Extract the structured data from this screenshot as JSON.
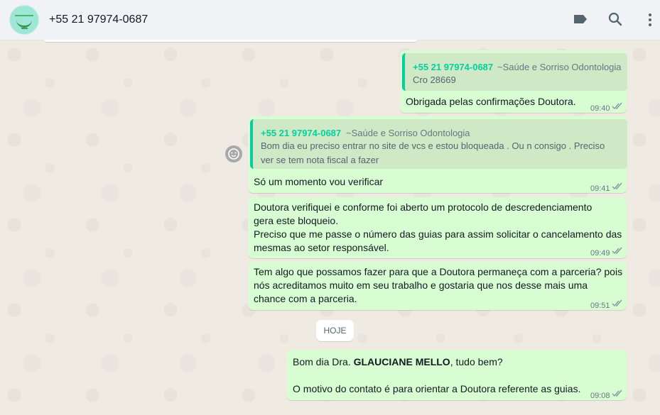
{
  "header": {
    "contact_name": "+55 21 97974-0687",
    "icons": [
      "label-icon",
      "search-icon",
      "menu-icon"
    ]
  },
  "colors": {
    "outgoing_bubble": "#d9fdd3",
    "quote_accent": "#06cf9c",
    "header_bg": "#f0f2f5",
    "chat_bg": "#efeae2"
  },
  "messages": [
    {
      "quote": {
        "sender": "+55 21 97974-0687",
        "push_name": "~Saúde e Sorriso Odontologia",
        "text": "Cro 28669"
      },
      "text": "Obrigada pelas confirmações Doutora.",
      "time": "09:40"
    },
    {
      "quote": {
        "sender": "+55 21 97974-0687",
        "push_name": "~Saúde e Sorriso Odontologia",
        "text_line1": "Bom dia eu preciso entrar no site de vcs e estou bloqueada . Ou n consigo . Preciso",
        "text_line2": "ver se tem nota fiscal a fazer"
      },
      "text": "Só um momento vou verificar",
      "time": "09:41"
    },
    {
      "text": "Doutora verifiquei e conforme foi aberto um protocolo de descredenciamento\ngera este bloqueio.\nPreciso que me passe o número das guias para assim solicitar o cancelamento das\nmesmas ao setor responsável.",
      "time": "09:49"
    },
    {
      "text": "Tem algo que possamos fazer para que a Doutora permaneça com a parceria? pois\nnós acreditamos muito em seu trabalho e gostaria que nos desse mais uma\nchance com a parceria.",
      "time": "09:51"
    },
    {
      "text_before_bold": "Bom dia Dra. ",
      "bold": "GLAUCIANE MELLO",
      "text_after_bold": ", tudo bem?",
      "text_line2": "O motivo do contato é para orientar a Doutora referente as guias.",
      "time": "09:08"
    }
  ],
  "day_separator": "HOJE"
}
